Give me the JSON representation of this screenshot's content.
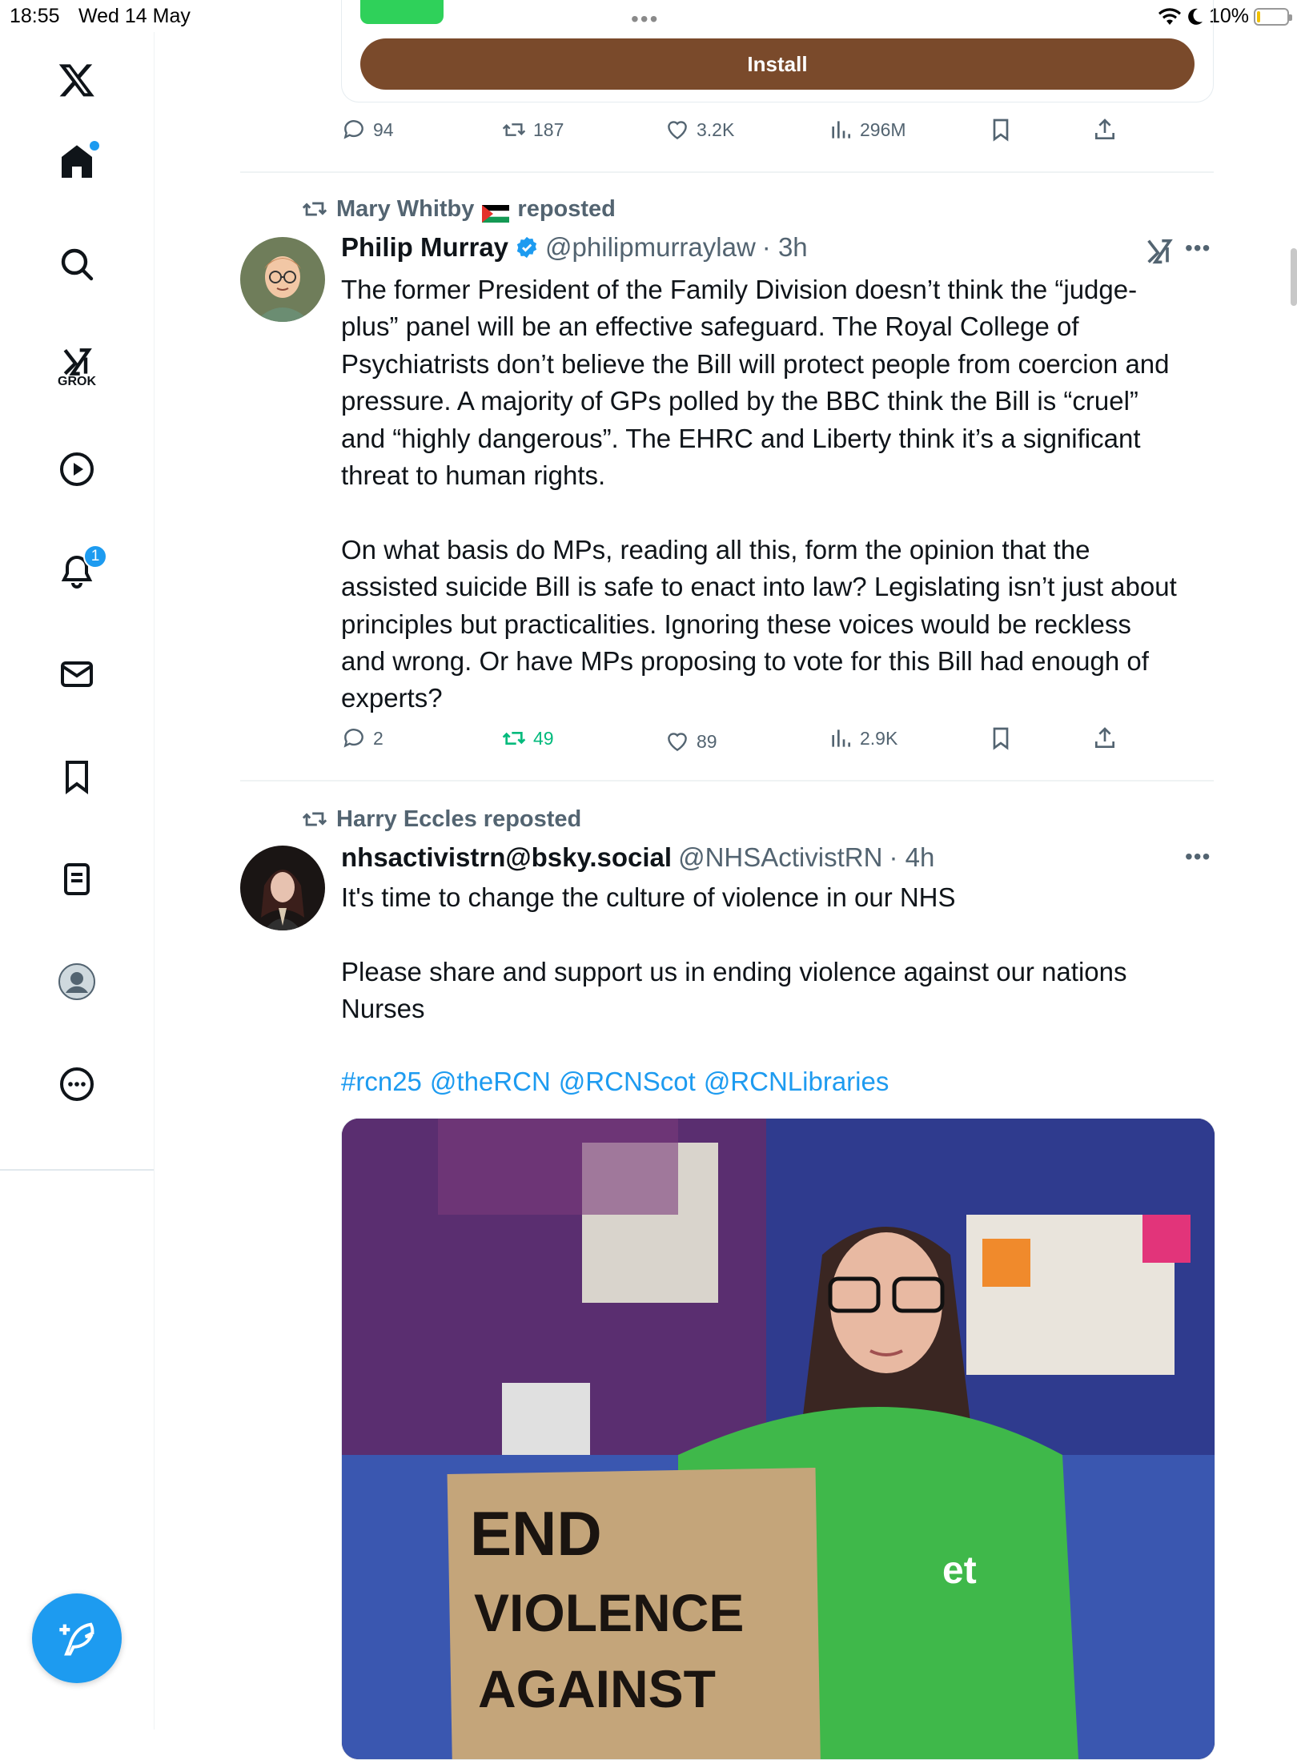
{
  "status_bar": {
    "time": "18:55",
    "date": "Wed 14 May",
    "battery": "10%",
    "battery_level": 0.1
  },
  "sidebar": {
    "grok_label": "GROK",
    "notifications_count": "1",
    "home_has_dot": true
  },
  "ad": {
    "install_label": "Install",
    "dots": "•••"
  },
  "tweet0_actions": {
    "replies": "94",
    "reposts": "187",
    "likes": "3.2K",
    "views": "296M"
  },
  "tweet1": {
    "reposted_by": "Mary Whitby",
    "reposted_suffix": "reposted",
    "display_name": "Philip Murray",
    "handle": "@philipmurraylaw",
    "time": "· 3h",
    "verified": true,
    "text": "The former President of the Family Division doesn’t think the “judge-\nplus” panel will be an effective safeguard. The Royal College of\nPsychiatrists don’t believe the Bill will protect people from coercion and\npressure. A majority of GPs polled by the BBC think the Bill is “cruel”\nand “highly dangerous”. The EHRC and Liberty think it’s a significant\nthreat to human rights.\n\nOn what basis do MPs, reading all this, form the opinion that the\nassisted suicide Bill is safe to enact into law? Legislating isn’t just about\nprinciples but practicalities. Ignoring these voices would be reckless\nand wrong. Or have MPs proposing to vote for this Bill had enough of\nexperts?",
    "actions": {
      "replies": "2",
      "reposts": "49",
      "likes": "89",
      "views": "2.9K"
    }
  },
  "tweet2": {
    "reposted_by": "Harry Eccles reposted",
    "display_name": "nhsactivistrn@bsky.social",
    "handle": "@NHSActivistRN",
    "time": "· 4h",
    "text": "It's time to change the culture of violence in our NHS\n\nPlease share and support us in ending violence against our nations\nNurses",
    "hashtags": [
      "#rcn25",
      "@theRCN",
      "@RCNScot",
      "@RCNLibraries"
    ],
    "image_sign_lines": [
      "END",
      "VIOLENCE",
      "AGAINST"
    ]
  },
  "colors": {
    "accent": "#1d9bf0",
    "repost_green": "#00ba7c",
    "install_brown": "#7a4a2b",
    "muted": "#536471"
  }
}
